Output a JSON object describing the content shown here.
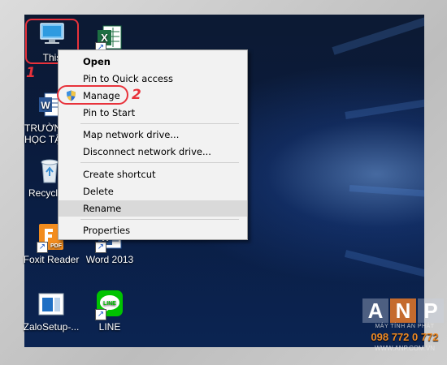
{
  "desktop": {
    "icons": [
      {
        "label": "This",
        "icon": "this-pc-icon"
      },
      {
        "label": "",
        "icon": "excel-icon"
      },
      {
        "label": "TRƯỜN",
        "label2": "HỌC TẬ",
        "icon": "word-doc-icon"
      },
      {
        "label": "Recycle",
        "icon": "recycle-bin-icon"
      },
      {
        "label": "Foxit Reader",
        "icon": "foxit-reader-icon"
      },
      {
        "label": "Word 2013",
        "icon": "word-2013-icon"
      },
      {
        "label": "ZaloSetup-...",
        "icon": "zalo-setup-icon"
      },
      {
        "label": "LINE",
        "icon": "line-app-icon"
      }
    ]
  },
  "annotations": {
    "step1": "1",
    "step2": "2"
  },
  "context_menu": {
    "items": [
      {
        "label": "Open",
        "bold": true
      },
      {
        "label": "Pin to Quick access"
      },
      {
        "label": "Manage",
        "icon": "uac-shield-icon"
      },
      {
        "label": "Pin to Start"
      },
      {
        "label": "Map network drive..."
      },
      {
        "label": "Disconnect network drive..."
      },
      {
        "label": "Create shortcut"
      },
      {
        "label": "Delete"
      },
      {
        "label": "Rename",
        "highlighted": true
      },
      {
        "label": "Properties"
      }
    ]
  },
  "watermark": {
    "letters": [
      "A",
      "N",
      "P"
    ],
    "tagline": "MÁY TÍNH AN PHÁT",
    "phone": "098 772 0 772",
    "website": "WWW.ANP.COM.VN"
  },
  "colors": {
    "annotation": "#e8323b",
    "menu_bg": "#f2f2f2",
    "menu_hover": "#d9d9d9"
  }
}
